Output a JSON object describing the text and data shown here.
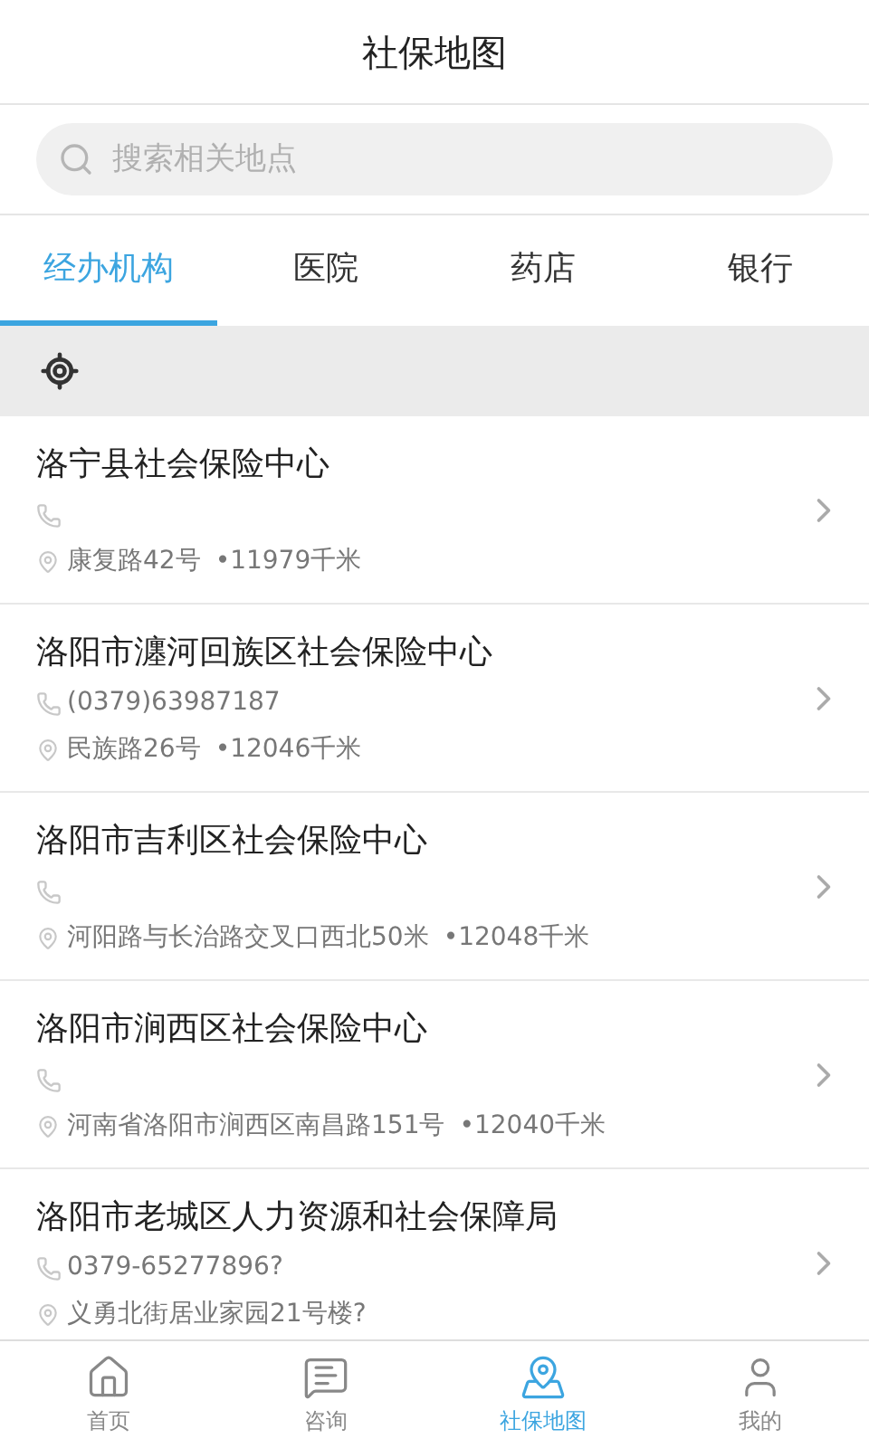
{
  "header": {
    "title": "社保地图"
  },
  "search": {
    "placeholder": "搜索相关地点"
  },
  "tabs": [
    {
      "label": "经办机构",
      "selected": true
    },
    {
      "label": "医院",
      "selected": false
    },
    {
      "label": "药店",
      "selected": false
    },
    {
      "label": "银行",
      "selected": false
    }
  ],
  "places": [
    {
      "name": "洛宁县社会保险中心",
      "address": "康复路42号",
      "distance": "•11979千米"
    },
    {
      "name": "洛阳市瀍河回族区社会保险中心",
      "phone": "(0379)63987187",
      "address": "民族路26号",
      "distance": "•12046千米"
    },
    {
      "name": "洛阳市吉利区社会保险中心",
      "address": "河阳路与长治路交叉口西北50米",
      "distance": "•12048千米"
    },
    {
      "name": "洛阳市涧西区社会保险中心",
      "address": "河南省洛阳市涧西区南昌路151号",
      "distance": "•12040千米"
    },
    {
      "name": "洛阳市老城区人力资源和社会保障局",
      "phone": "0379-65277896?",
      "address": "义勇北街居业家园21号楼?"
    }
  ],
  "bottom_nav": [
    {
      "label": "首页",
      "kind": "home",
      "selected": false
    },
    {
      "label": "咨询",
      "kind": "chat",
      "selected": false
    },
    {
      "label": "社保地图",
      "kind": "map",
      "selected": true
    },
    {
      "label": "我的",
      "kind": "user",
      "selected": false
    }
  ]
}
